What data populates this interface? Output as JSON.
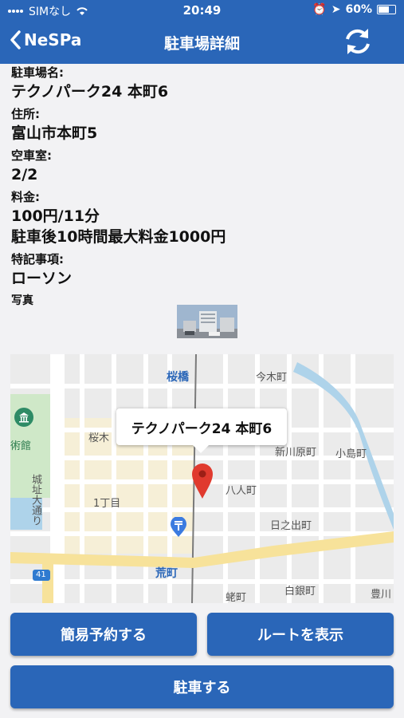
{
  "status_bar": {
    "carrier": "SIMなし",
    "time": "20:49",
    "battery": "60%",
    "battery_level": 0.6
  },
  "navbar": {
    "back_label": "NeSPa",
    "title": "駐車場詳細"
  },
  "details": {
    "name_label": "駐車場名:",
    "name_value": "テクノパーク24 本町6",
    "address_label": "住所:",
    "address_value": "富山市本町5",
    "vacancy_label": "空車室:",
    "vacancy_value": "2/2",
    "fee_label": "料金:",
    "fee_value_1": "100円/11分",
    "fee_value_2": "駐車後10時間最大料金1000円",
    "notes_label": "特記事項:",
    "notes_value": "ローソン",
    "photo_label": "写真"
  },
  "map": {
    "callout": "テクノパーク24 本町6",
    "labels": {
      "sakurabashi": "桜橋",
      "imaki": "今木町",
      "shinkawara": "新川原町",
      "kojima": "小島町",
      "sakuragi": "桜木",
      "museum": "術館",
      "hachinin": "八人町",
      "itchome": "1丁目",
      "hinode": "日之出町",
      "street": "城址大通り",
      "arakawa": "荒町",
      "route": "41",
      "shirogane": "白銀町",
      "tsurugi": "蛯町",
      "toyokawa": "豊川"
    }
  },
  "buttons": {
    "reserve": "簡易予約する",
    "route": "ルートを表示",
    "park": "駐車する"
  },
  "colors": {
    "primary": "#2a66b8",
    "pin": "#e03a2e"
  }
}
